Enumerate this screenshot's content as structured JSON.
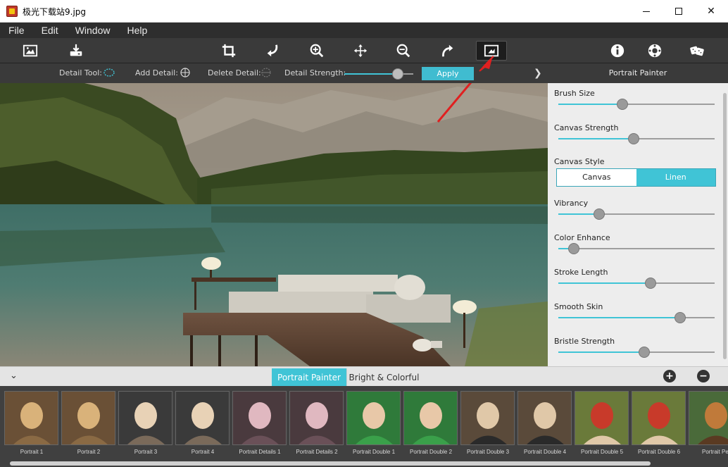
{
  "window": {
    "title": "极光下载站9.jpg",
    "minimize": "minimize",
    "maximize": "maximize",
    "close": "close"
  },
  "menu": [
    "File",
    "Edit",
    "Window",
    "Help"
  ],
  "toolbar": {
    "left_icons": [
      "image-icon",
      "export-icon"
    ],
    "center_icons": [
      "crop-icon",
      "undo-icon",
      "zoom-in-icon",
      "move-icon",
      "zoom-out-icon",
      "redo-icon",
      "detail-brush-icon"
    ],
    "right_icons": [
      "info-icon",
      "settings-icon",
      "random-icon"
    ]
  },
  "detail_bar": {
    "detail_tool": "Detail Tool:",
    "add_detail": "Add Detail:",
    "delete_detail": "Delete Detail:",
    "detail_strength": "Detail Strength:",
    "strength_value": 0.78,
    "apply": "Apply"
  },
  "panel": {
    "title": "Portrait Painter",
    "params": [
      {
        "label": "Brush Size",
        "value": 0.41
      },
      {
        "label": "Canvas Strength",
        "value": 0.48
      },
      {
        "label": "Vibrancy",
        "value": 0.26
      },
      {
        "label": "Color Enhance",
        "value": 0.1
      },
      {
        "label": "Stroke Length",
        "value": 0.59
      },
      {
        "label": "Smooth Skin",
        "value": 0.78
      },
      {
        "label": "Bristle Strength",
        "value": 0.55
      }
    ],
    "canvas_style_label": "Canvas Style",
    "canvas_style_options": [
      "Canvas",
      "Linen"
    ],
    "canvas_style_selected": "Linen"
  },
  "tabs": [
    "Portrait Painter",
    "Bright & Colorful"
  ],
  "thumbnails": [
    "Portrait 1",
    "Portrait 2",
    "Portrait 3",
    "Portrait 4",
    "Portrait Details 1",
    "Portrait Details 2",
    "Portrait Double 1",
    "Portrait Double 2",
    "Portrait Double 3",
    "Portrait Double 4",
    "Portrait Double 5",
    "Portrait Double 6",
    "Portrait Pet"
  ],
  "colors": {
    "accent": "#40c4d6",
    "arrow": "#e02020",
    "toolbar": "#3a3a3a"
  }
}
